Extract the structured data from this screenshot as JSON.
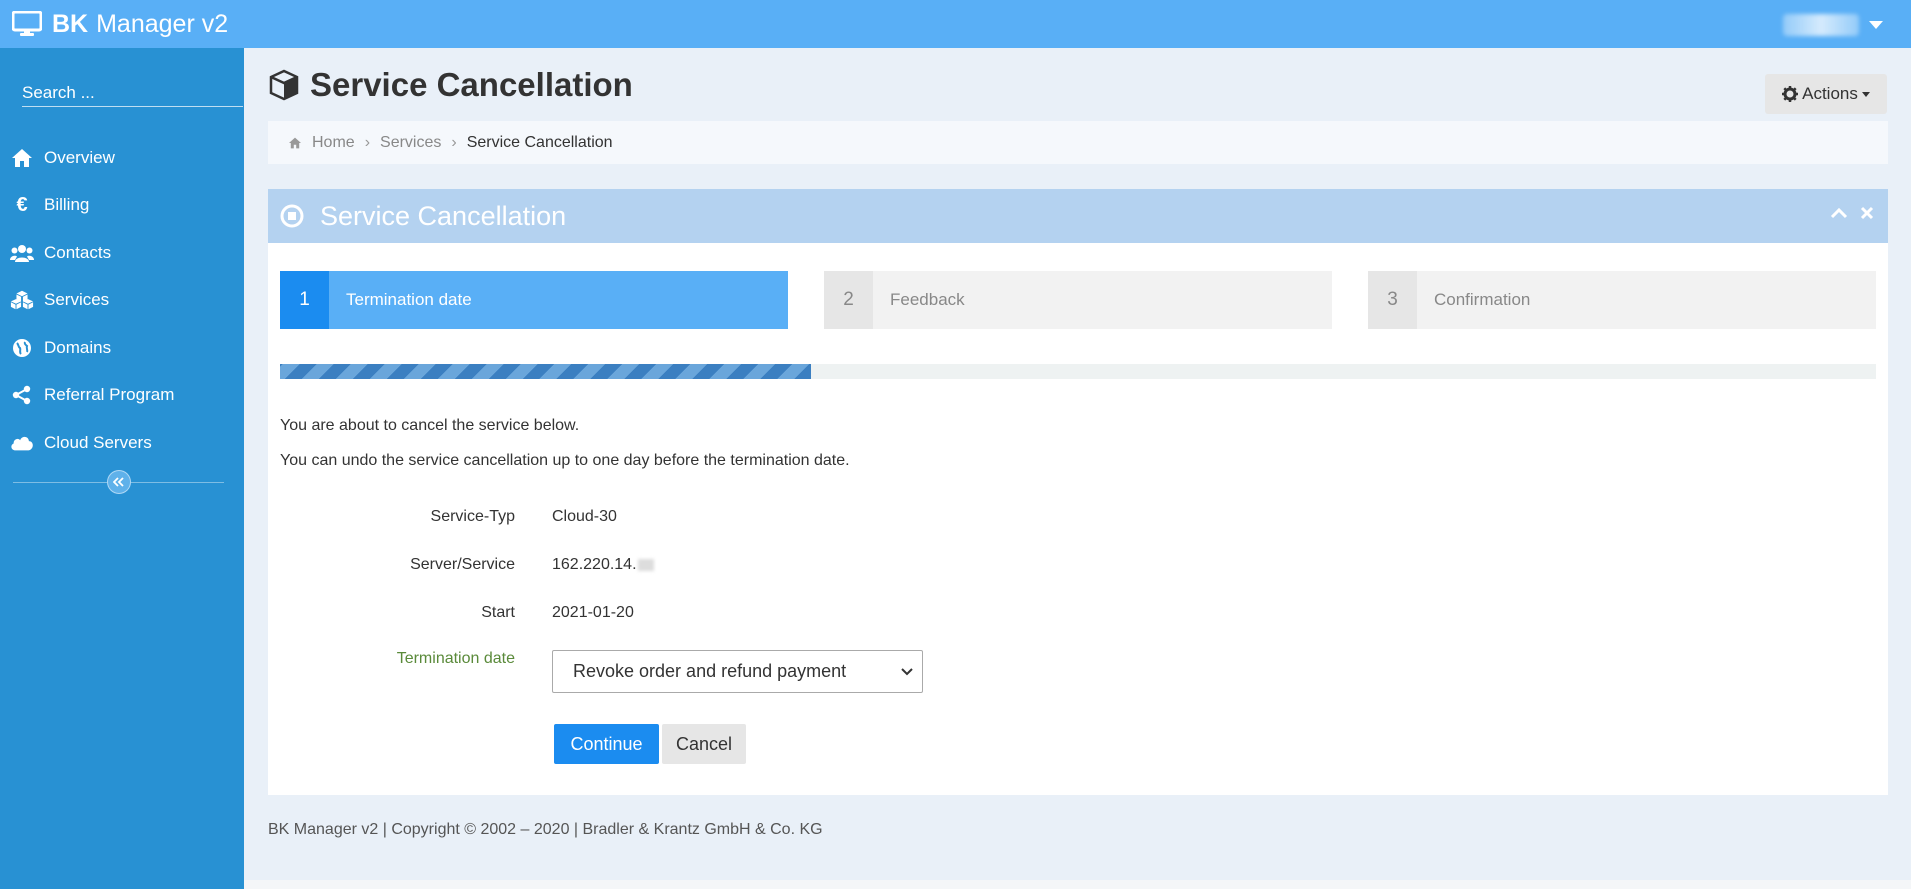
{
  "app": {
    "title_bold": "BK",
    "title_rest": "Manager v2"
  },
  "sidebar": {
    "search_placeholder": "Search ...",
    "items": [
      {
        "label": "Overview",
        "icon": "home-icon"
      },
      {
        "label": "Billing",
        "icon": "euro-icon"
      },
      {
        "label": "Contacts",
        "icon": "users-icon"
      },
      {
        "label": "Services",
        "icon": "cubes-icon"
      },
      {
        "label": "Domains",
        "icon": "globe-icon"
      },
      {
        "label": "Referral Program",
        "icon": "share-icon"
      },
      {
        "label": "Cloud Servers",
        "icon": "cloud-icon"
      }
    ]
  },
  "header": {
    "page_title": "Service Cancellation",
    "actions_label": "Actions"
  },
  "breadcrumb": {
    "items": [
      "Home",
      "Services",
      "Service Cancellation"
    ]
  },
  "panel": {
    "title": "Service Cancellation",
    "steps": [
      {
        "num": "1",
        "label": "Termination date",
        "active": true
      },
      {
        "num": "2",
        "label": "Feedback",
        "active": false
      },
      {
        "num": "3",
        "label": "Confirmation",
        "active": false
      }
    ],
    "progress_fraction": 0.333,
    "intro_line1": "You are about to cancel the service below.",
    "intro_line2": "You can undo the service cancellation up to one day before the termination date.",
    "fields": {
      "service_type_label": "Service-Typ",
      "service_type_value": "Cloud-30",
      "server_label": "Server/Service",
      "server_value": "162.220.14.",
      "start_label": "Start",
      "start_value": "2021-01-20",
      "termination_label": "Termination date",
      "termination_selected": "Revoke order and refund payment"
    },
    "buttons": {
      "continue": "Continue",
      "cancel": "Cancel"
    }
  },
  "footer": {
    "text": "BK Manager v2 | Copyright © 2002 – 2020 | Bradler & Krantz GmbH & Co. KG"
  },
  "colors": {
    "topbar": "#59aff6",
    "sidebar": "#2891d3",
    "primary": "#1b8cf0",
    "panel_header": "#b4d2f0"
  }
}
